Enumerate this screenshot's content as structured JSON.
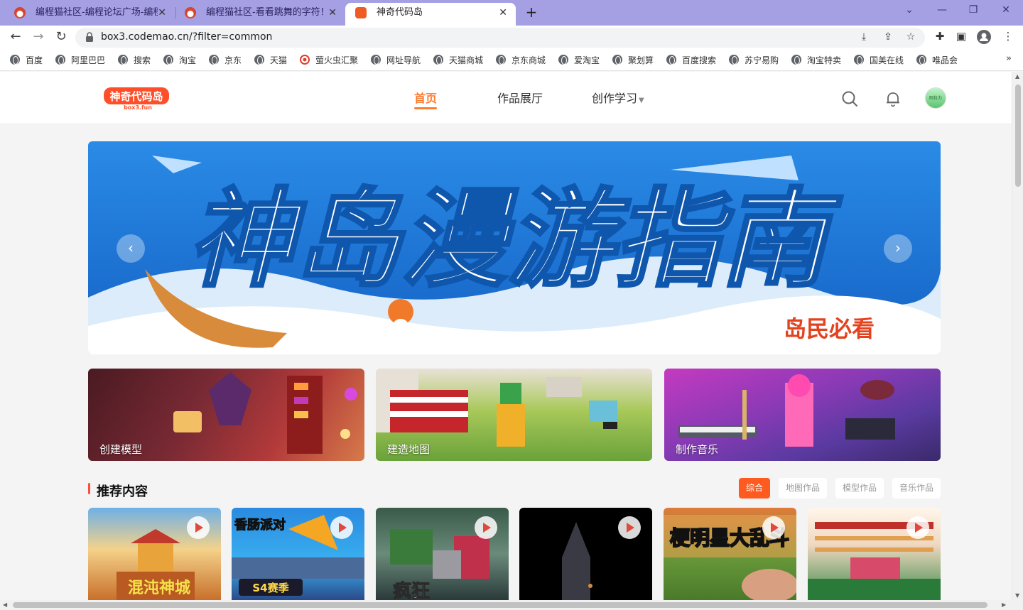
{
  "browser": {
    "tabs": [
      {
        "title": "编程猫社区-编程论坛广场-编程学",
        "active": false
      },
      {
        "title": "编程猫社区-看看跳舞的字符！!",
        "active": false
      },
      {
        "title": "神奇代码岛",
        "active": true
      }
    ],
    "new_tab": "+",
    "url": "box3.codemao.cn/?filter=common",
    "window_controls": [
      "minimize-icon",
      "restore-icon",
      "close-icon"
    ],
    "bookmarks": [
      "百度",
      "阿里巴巴",
      "搜索",
      "淘宝",
      "京东",
      "天猫",
      "萤火虫汇聚",
      "网址导航",
      "天猫商城",
      "京东商城",
      "爱淘宝",
      "聚划算",
      "百度搜索",
      "苏宁易购",
      "淘宝特卖",
      "国美在线",
      "唯品会"
    ],
    "bookmarks_more": "»"
  },
  "site": {
    "logo_text": "神奇代码岛",
    "logo_sub": "box3.fun",
    "nav": {
      "home": "首页",
      "gallery": "作品展厅",
      "learn": "创作学习"
    },
    "avatar_text": "阿拉力"
  },
  "banner": {
    "headline": "神岛漫游指南",
    "badge": "岛民必看",
    "prev": "‹",
    "next": "›"
  },
  "categories": [
    {
      "label": "创建模型"
    },
    {
      "label": "建造地图"
    },
    {
      "label": "制作音乐"
    }
  ],
  "recommend": {
    "title": "推荐内容",
    "filters": [
      "综合",
      "地图作品",
      "模型作品",
      "音乐作品"
    ],
    "thumbs": [
      {
        "title": "混沌神城"
      },
      {
        "title": "香肠派对",
        "sub": "S4赛季"
      },
      {
        "title": "疯狂"
      },
      {
        "title": ""
      },
      {
        "title": "梗明星大乱斗"
      },
      {
        "title": ""
      }
    ]
  },
  "colors": {
    "tabbar": "#a59fe4",
    "accent": "#ff7b2e",
    "filter_active": "#ff5a1f",
    "banner_sky": "#1e7fd8"
  }
}
